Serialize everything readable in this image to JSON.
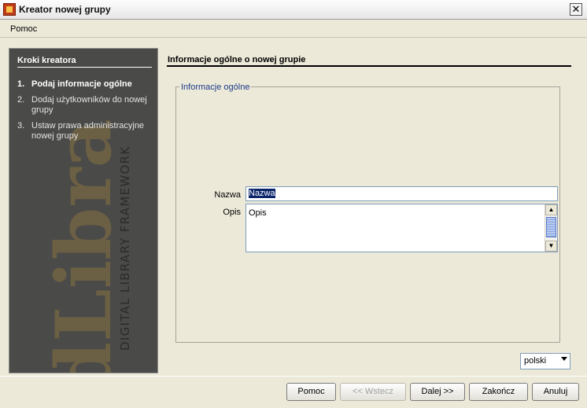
{
  "window": {
    "title": "Kreator nowej grupy",
    "close_glyph": "✕",
    "icon": "app-icon"
  },
  "menu": {
    "items": [
      {
        "label": "Pomoc"
      }
    ]
  },
  "steps": {
    "title": "Kroki kreatora",
    "watermark_brand": "dLibra",
    "watermark_tagline": "DIGITAL LIBRARY FRAMEWORK",
    "items": [
      {
        "num": "1.",
        "label": "Podaj informacje ogólne",
        "active": true
      },
      {
        "num": "2.",
        "label": "Dodaj użytkowników do nowej grupy",
        "active": false
      },
      {
        "num": "3.",
        "label": "Ustaw prawa administracyjne nowej grupy",
        "active": false
      }
    ]
  },
  "main": {
    "section_title": "Informacje ogólne o nowej grupie",
    "group_legend": "Informacje ogólne",
    "name_label": "Nazwa",
    "name_value": "Nazwa",
    "desc_label": "Opis",
    "desc_value": "Opis",
    "language": {
      "selected": "polski"
    }
  },
  "buttons": {
    "help": "Pomoc",
    "back": "<< Wstecz",
    "next": "Dalej >>",
    "finish": "Zakończ",
    "cancel": "Anuluj"
  },
  "colors": {
    "panel_bg": "#4a4a48",
    "watermark": "#6b5f44",
    "legend_text": "#1c3a8a",
    "selection": "#0a246a"
  }
}
